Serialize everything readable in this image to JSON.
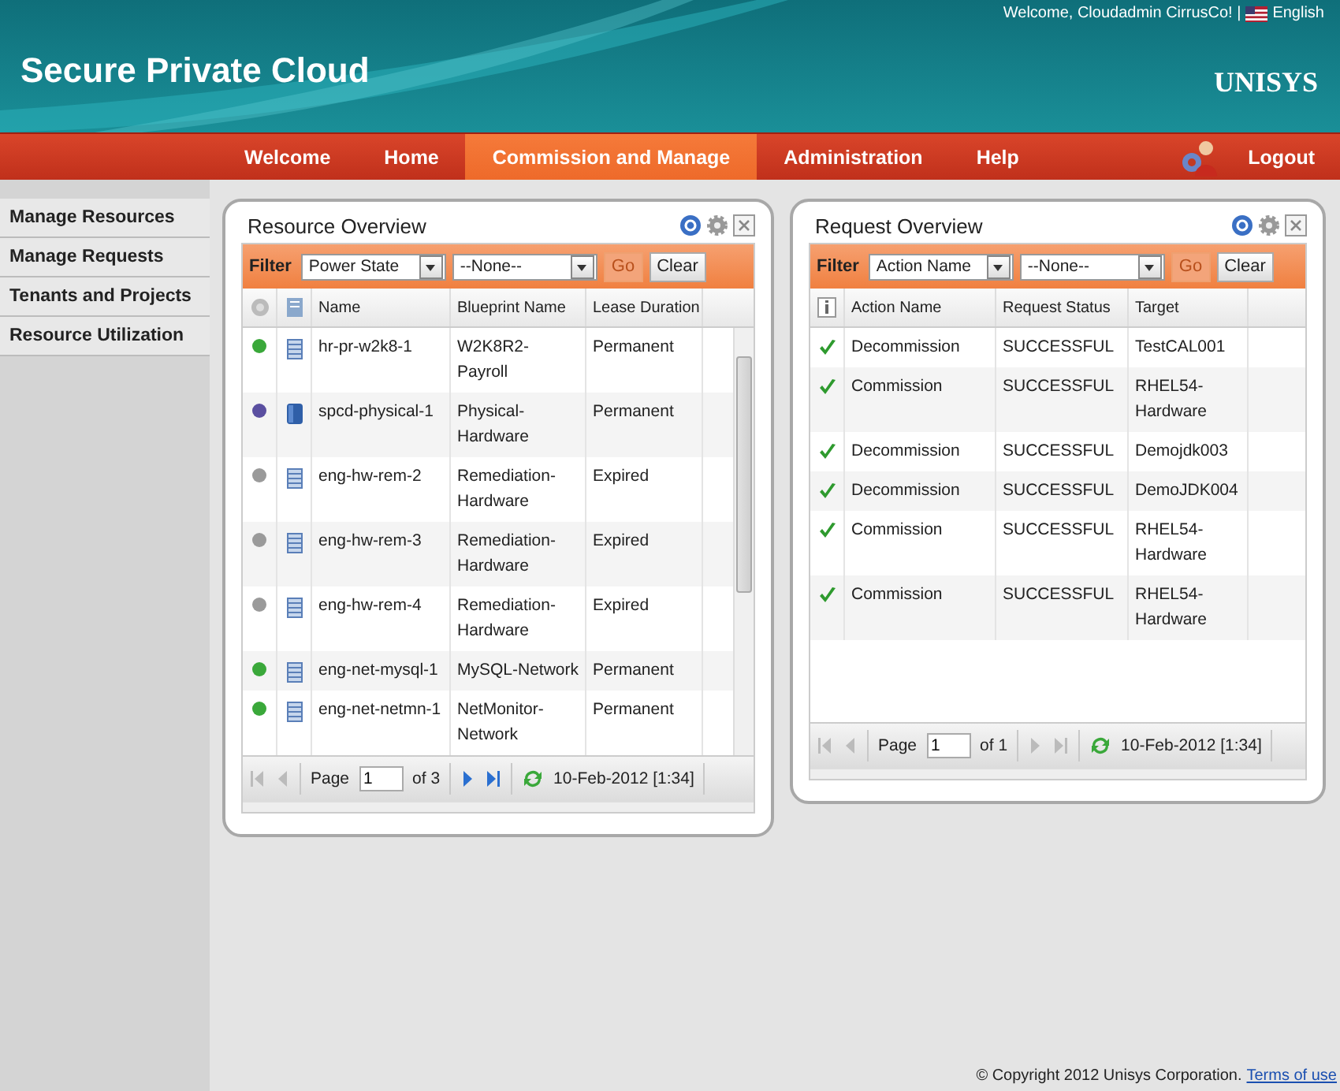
{
  "header": {
    "title": "Secure Private Cloud",
    "welcome": "Welcome, Cloudadmin CirrusCo! |",
    "language": "English",
    "logo": "UNISYS"
  },
  "nav": {
    "items": [
      {
        "label": "Welcome",
        "selected": false
      },
      {
        "label": "Home",
        "selected": false
      },
      {
        "label": "Commission and Manage",
        "selected": true
      },
      {
        "label": "Administration",
        "selected": false
      },
      {
        "label": "Help",
        "selected": false
      }
    ],
    "logout": "Logout"
  },
  "sidebar": {
    "items": [
      "Manage Resources",
      "Manage Requests",
      "Tenants and Projects",
      "Resource Utilization"
    ]
  },
  "panels": [
    {
      "kind": "resource",
      "title": "Resource Overview",
      "filter": {
        "label": "Filter",
        "field": "Power State",
        "value": "--None--",
        "go": "Go",
        "go_disabled": true,
        "clear": "Clear"
      },
      "columns": [
        "Name",
        "Blueprint Name",
        "Lease Duration"
      ],
      "rows": [
        {
          "color": "#3aa83a",
          "kind": "vm",
          "cells": [
            "hr-pr-w2k8-1",
            "W2K8R2-Payroll",
            "Permanent"
          ]
        },
        {
          "color": "#5a4fa0",
          "kind": "physical",
          "cells": [
            "spcd-physical-1",
            "Physical-Hardware",
            "Permanent"
          ]
        },
        {
          "color": "#9a9a9a",
          "kind": "vm",
          "cells": [
            "eng-hw-rem-2",
            "Remediation-Hardware",
            "Expired"
          ]
        },
        {
          "color": "#9a9a9a",
          "kind": "vm",
          "cells": [
            "eng-hw-rem-3",
            "Remediation-Hardware",
            "Expired"
          ]
        },
        {
          "color": "#9a9a9a",
          "kind": "vm",
          "cells": [
            "eng-hw-rem-4",
            "Remediation-Hardware",
            "Expired"
          ]
        },
        {
          "color": "#3aa83a",
          "kind": "vm",
          "cells": [
            "eng-net-mysql-1",
            "MySQL-Network",
            "Permanent"
          ]
        },
        {
          "color": "#3aa83a",
          "kind": "vm",
          "cells": [
            "eng-net-netmn-1",
            "NetMonitor-Network",
            "Permanent"
          ]
        }
      ],
      "pager": {
        "page_label": "Page",
        "page": "1",
        "of": "of 3",
        "first_disabled": true,
        "prev_disabled": true,
        "next_disabled": false,
        "last_disabled": false,
        "updated": "10-Feb-2012 [1:34]"
      }
    },
    {
      "kind": "request",
      "title": "Request Overview",
      "filter": {
        "label": "Filter",
        "field": "Action Name",
        "value": "--None--",
        "go": "Go",
        "go_disabled": true,
        "clear": "Clear"
      },
      "columns": [
        "Action Name",
        "Request Status",
        "Target"
      ],
      "rows": [
        {
          "kind": "success",
          "cells": [
            "Decommission",
            "SUCCESSFUL",
            "TestCAL001"
          ]
        },
        {
          "kind": "success",
          "cells": [
            "Commission",
            "SUCCESSFUL",
            "RHEL54-Hardware"
          ]
        },
        {
          "kind": "success",
          "cells": [
            "Decommission",
            "SUCCESSFUL",
            "Demojdk003"
          ]
        },
        {
          "kind": "success",
          "cells": [
            "Decommission",
            "SUCCESSFUL",
            "DemoJDK004"
          ]
        },
        {
          "kind": "success",
          "cells": [
            "Commission",
            "SUCCESSFUL",
            "RHEL54-Hardware"
          ]
        },
        {
          "kind": "success",
          "cells": [
            "Commission",
            "SUCCESSFUL",
            "RHEL54-Hardware"
          ]
        }
      ],
      "pager": {
        "page_label": "Page",
        "page": "1",
        "of": "of 1",
        "first_disabled": true,
        "prev_disabled": true,
        "next_disabled": true,
        "last_disabled": true,
        "updated": "10-Feb-2012 [1:34]"
      }
    }
  ],
  "footer": {
    "copyright": "© Copyright 2012 Unisys Corporation.",
    "link": "Terms of use"
  }
}
